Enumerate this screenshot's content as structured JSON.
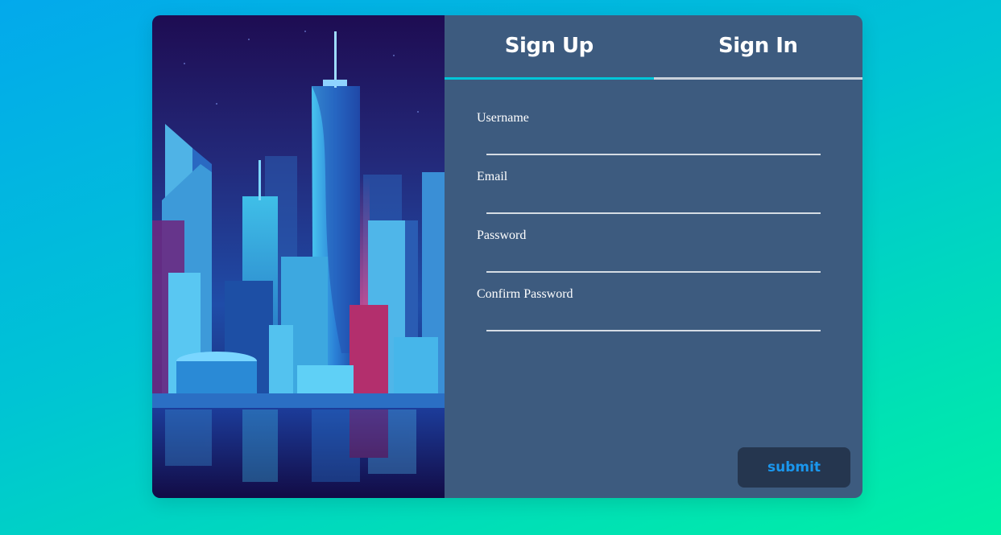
{
  "tabs": [
    {
      "label": "Sign Up",
      "active": true
    },
    {
      "label": "Sign In",
      "active": false
    }
  ],
  "form": {
    "fields": [
      {
        "label": "Username",
        "value": ""
      },
      {
        "label": "Email",
        "value": ""
      },
      {
        "label": "Password",
        "value": ""
      },
      {
        "label": "Confirm Password",
        "value": ""
      }
    ],
    "submit_label": "submit"
  },
  "colors": {
    "panel": "#3d5b7f",
    "active_tab_underline": "#00c6d8",
    "submit_text": "#1a97ee",
    "submit_bg": "#25364f"
  },
  "illustration": {
    "icon": "city-skyline-illustration"
  }
}
